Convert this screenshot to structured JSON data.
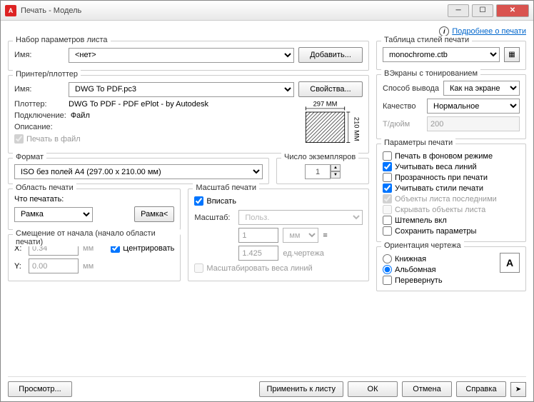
{
  "window": {
    "title": "Печать - Модель"
  },
  "info_link": "Подробнее о печати",
  "page_setup": {
    "title": "Набор параметров листа",
    "name_label": "Имя:",
    "name_value": "<нет>",
    "add_btn": "Добавить..."
  },
  "printer": {
    "title": "Принтер/плоттер",
    "name_label": "Имя:",
    "name_value": "DWG To PDF.pc3",
    "props_btn": "Свойства...",
    "plotter_label": "Плоттер:",
    "plotter_value": "DWG To PDF - PDF ePlot - by Autodesk",
    "conn_label": "Подключение:",
    "conn_value": "Файл",
    "desc_label": "Описание:",
    "to_file": "Печать в файл",
    "preview_w": "297 MM",
    "preview_h": "210 MM"
  },
  "paper": {
    "title": "Формат",
    "value": "ISO без полей A4 (297.00 x 210.00 мм)"
  },
  "copies": {
    "title": "Число экземпляров",
    "value": "1"
  },
  "area": {
    "title": "Область печати",
    "what_label": "Что печатать:",
    "what_value": "Рамка",
    "window_btn": "Рамка<"
  },
  "scale": {
    "title": "Масштаб печати",
    "fit": "Вписать",
    "scale_label": "Масштаб:",
    "scale_value": "Польз.",
    "num": "1",
    "unit": "мм",
    "equal": "=",
    "den": "1.425",
    "den_unit": "ед.чертежа",
    "scale_weights": "Масштабировать веса линий"
  },
  "offset": {
    "title": "Смещение от начала (начало области печати)",
    "x_label": "X:",
    "x_value": "0.34",
    "y_label": "Y:",
    "y_value": "0.00",
    "unit": "мм",
    "center": "Центрировать"
  },
  "styles": {
    "title": "Таблица стилей печати",
    "value": "monochrome.ctb"
  },
  "shade": {
    "title": "ВЭкраны с тонированием",
    "method_label": "Способ вывода",
    "method_value": "Как на экране",
    "quality_label": "Качество",
    "quality_value": "Нормальное",
    "dpi_label": "Т/дюйм",
    "dpi_value": "200"
  },
  "options": {
    "title": "Параметры печати",
    "bg": "Печать в фоновом режиме",
    "weights": "Учитывать веса линий",
    "transp": "Прозрачность при печати",
    "plot_styles": "Учитывать стили печати",
    "paperspace": "Объекты листа последними",
    "hide": "Скрывать объекты листа",
    "stamp": "Штемпель вкл",
    "save": "Сохранить параметры"
  },
  "orient": {
    "title": "Ориентация чертежа",
    "portrait": "Книжная",
    "landscape": "Альбомная",
    "upside": "Перевернуть"
  },
  "footer": {
    "preview": "Просмотр...",
    "apply": "Применить к листу",
    "ok": "ОК",
    "cancel": "Отмена",
    "help": "Справка"
  }
}
